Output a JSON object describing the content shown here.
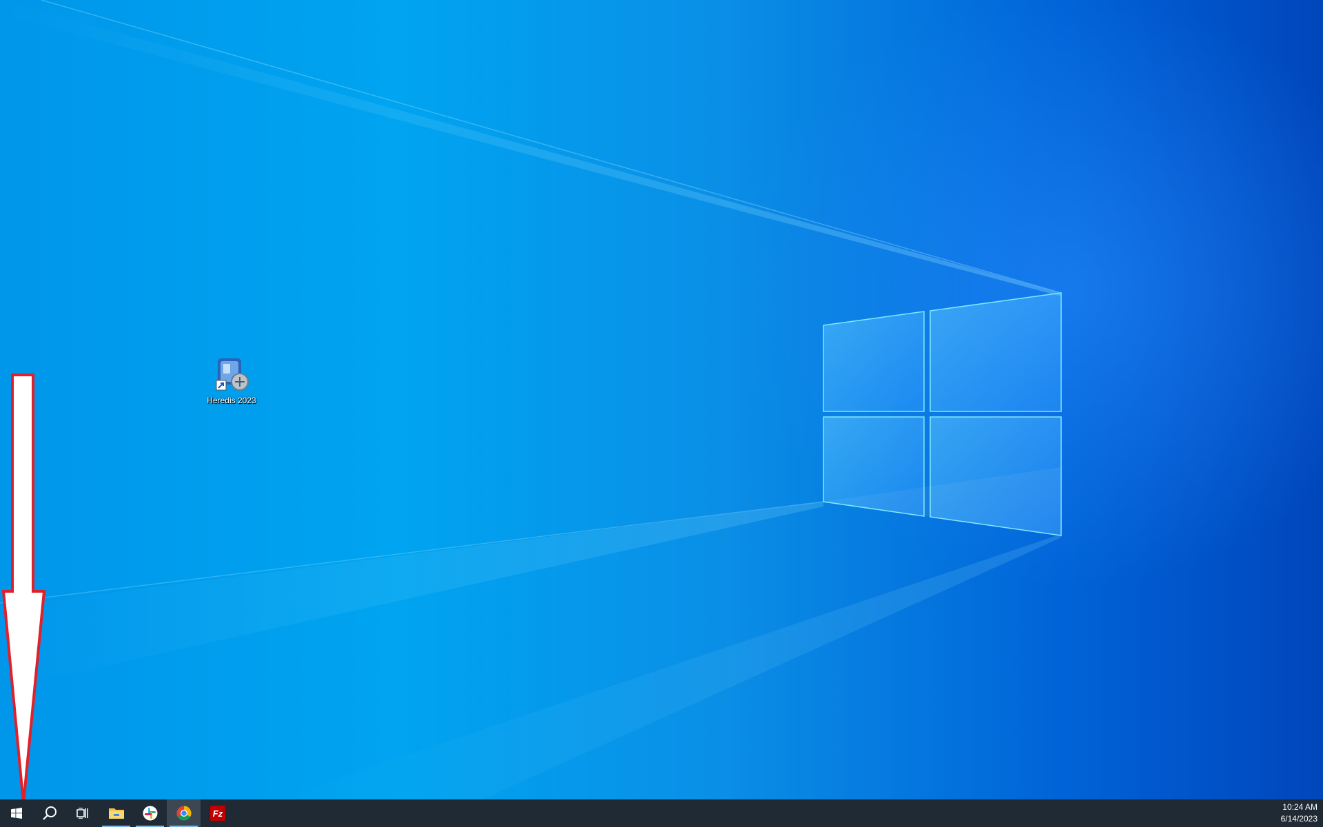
{
  "desktop": {
    "icons": [
      {
        "label": "Heredis 2023",
        "icon": "heredis-app-icon"
      }
    ]
  },
  "taskbar": {
    "start_icon": "windows-logo-icon",
    "search_icon": "search-icon",
    "task_view_icon": "task-view-icon",
    "pinned_apps": [
      {
        "name": "file-explorer",
        "icon": "folder-icon",
        "running": true
      },
      {
        "name": "slack",
        "icon": "slack-icon",
        "running": true
      },
      {
        "name": "google-chrome",
        "icon": "chrome-icon",
        "running": true,
        "active": true
      },
      {
        "name": "filezilla",
        "icon": "filezilla-icon",
        "running": false
      }
    ],
    "clock": {
      "time": "10:24 AM",
      "date": "6/14/2023"
    }
  },
  "colors": {
    "taskbar_bg": "#1f2a35",
    "annotation_arrow_outline": "#e0202a",
    "wallpaper_blue": "#00a4f0"
  }
}
